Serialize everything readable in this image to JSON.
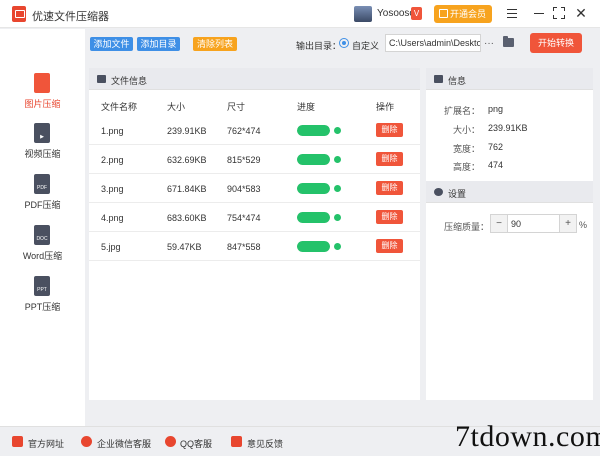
{
  "app": {
    "title": "优速文件压缩器"
  },
  "user": {
    "name": "Yosoosoft",
    "badge": "V"
  },
  "titlebar": {
    "member_label": "开通会员"
  },
  "sidebar": {
    "items": [
      {
        "label": "图片压缩",
        "icon_text": "",
        "active": true
      },
      {
        "label": "视频压缩",
        "icon_text": ""
      },
      {
        "label": "PDF压缩",
        "icon_text": "PDF"
      },
      {
        "label": "Word压缩",
        "icon_text": "DOC"
      },
      {
        "label": "PPT压缩",
        "icon_text": "PPT"
      }
    ]
  },
  "toolbar": {
    "add_file": "添加文件",
    "add_folder": "添加目录",
    "clear_list": "清除列表",
    "output_label": "输出目录：",
    "custom_label": "自定义",
    "output_path": "C:\\Users\\admin\\Deskto",
    "browse": "···",
    "start": "开始转换"
  },
  "files": {
    "panel_title": "文件信息",
    "headers": {
      "name": "文件名称",
      "size": "大小",
      "dims": "尺寸",
      "progress": "进度",
      "action": "操作"
    },
    "delete_label": "删除",
    "rows": [
      {
        "name": "1.png",
        "size": "239.91KB",
        "dims": "762*474",
        "progress": 1.0
      },
      {
        "name": "2.png",
        "size": "632.69KB",
        "dims": "815*529",
        "progress": 1.0
      },
      {
        "name": "3.png",
        "size": "671.84KB",
        "dims": "904*583",
        "progress": 1.0
      },
      {
        "name": "4.png",
        "size": "683.60KB",
        "dims": "754*474",
        "progress": 1.0
      },
      {
        "name": "5.jpg",
        "size": "59.47KB",
        "dims": "847*558",
        "progress": 1.0
      }
    ]
  },
  "info": {
    "panel_title": "信息",
    "ext_label": "扩展名：",
    "ext": "png",
    "size_label": "大小：",
    "size": "239.91KB",
    "width_label": "宽度：",
    "width": "762",
    "height_label": "高度：",
    "height": "474"
  },
  "settings": {
    "panel_title": "设置",
    "quality_label": "压缩质量：",
    "quality_value": "90",
    "minus": "−",
    "plus": "+",
    "unit": "%"
  },
  "footer": {
    "website": "官方网址",
    "wechat": "企业微信客服",
    "qq": "QQ客服",
    "feedback": "意见反馈"
  },
  "watermark": "7tdown.com",
  "colors": {
    "accent": "#f0553a",
    "blue": "#3e8fe6",
    "orange": "#f7a31e",
    "progress": "#24c26a"
  }
}
